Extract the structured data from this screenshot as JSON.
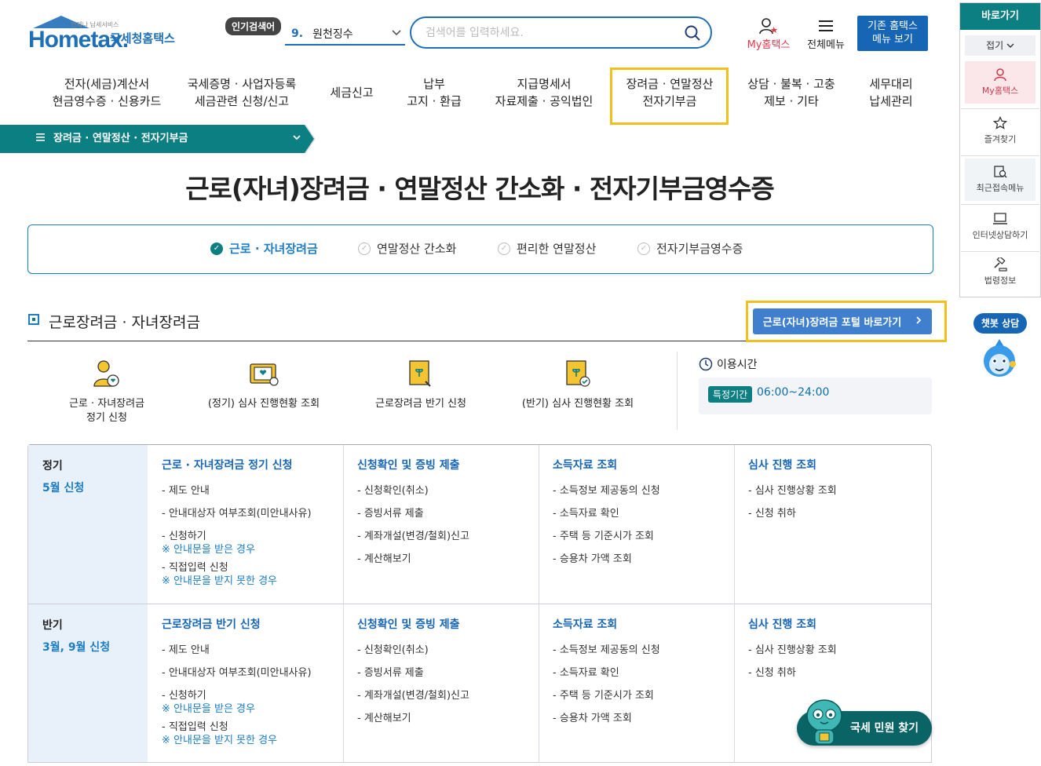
{
  "logo": {
    "brand": "Hometax.",
    "sub": "국세청홈택스",
    "tagline": "언제나 납세서비스"
  },
  "header": {
    "popular_badge": "인기검색어",
    "popular_rank": "9.",
    "popular_term": "원천징수",
    "search_placeholder": "검색어를 입력하세요.",
    "my_hometax": "My홈택스",
    "all_menu": "전체메뉴",
    "old_hometax_l1": "기존 홈택스",
    "old_hometax_l2": "메뉴 보기"
  },
  "gnb": [
    {
      "l1": "전자(세금)계산서",
      "l2": "현금영수증 · 신용카드"
    },
    {
      "l1": "국세증명 · 사업자등록",
      "l2": "세금관련 신청/신고"
    },
    {
      "l1": "세금신고",
      "l2": ""
    },
    {
      "l1": "납부",
      "l2": "고지 · 환급"
    },
    {
      "l1": "지급명세서",
      "l2": "자료제출 · 공익법인"
    },
    {
      "l1": "장려금 · 연말정산",
      "l2": "전자기부금"
    },
    {
      "l1": "상담 · 불복 · 고충",
      "l2": "제보 · 기타"
    },
    {
      "l1": "세무대리",
      "l2": "납세관리"
    }
  ],
  "breadcrumb": {
    "label": "장려금 · 연말정산 · 전자기부금"
  },
  "page_title": "근로(자녀)장려금 · 연말정산 간소화 · 전자기부금영수증",
  "tabs": [
    {
      "label": "근로 · 자녀장려금"
    },
    {
      "label": "연말정산 간소화"
    },
    {
      "label": "편리한 연말정산"
    },
    {
      "label": "전자기부금영수증"
    }
  ],
  "section": {
    "title": "근로장려금 · 자녀장려금",
    "portal_button": "근로(자녀)장려금 포털 바로가기"
  },
  "quick_icons": [
    {
      "l1": "근로 · 자녀장려금",
      "l2": "정기 신청"
    },
    {
      "l1": "(정기) 심사 진행현황 조회",
      "l2": ""
    },
    {
      "l1": "근로장려금 반기 신청",
      "l2": ""
    },
    {
      "l1": "(반기) 심사 진행현황 조회",
      "l2": ""
    }
  ],
  "usage_time": {
    "label": "이용시간",
    "badge": "특정기간",
    "value": "06:00~24:00"
  },
  "table": {
    "rows": [
      {
        "head": "정기",
        "sub": "5월 신청",
        "cols": [
          {
            "title": "근로 · 자녀장려금 정기 신청",
            "items": [
              "- 제도 안내",
              "- 안내대상자 여부조회(미안내사유)",
              "- 신청하기"
            ],
            "note1": "※ 안내문을 받은 경우",
            "item4": "- 직접입력 신청",
            "note2": "※ 안내문을 받지 못한 경우"
          },
          {
            "title": "신청확인 및 증빙 제출",
            "items": [
              "- 신청확인(취소)",
              "- 증빙서류 제출",
              "- 계좌개설(변경/철회)신고",
              "- 계산해보기"
            ]
          },
          {
            "title": "소득자료 조회",
            "items": [
              "- 소득정보 제공동의 신청",
              "- 소득자료 확인",
              "- 주택 등 기준시가 조회",
              "- 승용차 가액 조회"
            ]
          },
          {
            "title": "심사 진행 조회",
            "items": [
              "- 심사 진행상황 조회",
              "- 신청 취하"
            ]
          }
        ]
      },
      {
        "head": "반기",
        "sub": "3월, 9월 신청",
        "cols": [
          {
            "title": "근로장려금 반기 신청",
            "items": [
              "- 제도 안내",
              "- 안내대상자 여부조회(미안내사유)",
              "- 신청하기"
            ],
            "note1": "※ 안내문을 받은 경우",
            "item4": "- 직접입력 신청",
            "note2": "※ 안내문을 받지 못한 경우"
          },
          {
            "title": "신청확인 및 증빙 제출",
            "items": [
              "- 신청확인(취소)",
              "- 증빙서류 제출",
              "- 계좌개설(변경/철회)신고",
              "- 계산해보기"
            ]
          },
          {
            "title": "소득자료 조회",
            "items": [
              "- 소득정보 제공동의 신청",
              "- 소득자료 확인",
              "- 주택 등 기준시가 조회",
              "- 승용차 가액 조회"
            ]
          },
          {
            "title": "심사 진행 조회",
            "items": [
              "- 심사 진행상황 조회",
              "- 신청 취하"
            ]
          }
        ]
      }
    ]
  },
  "quick_panel": {
    "title": "바로가기",
    "fold": "접기",
    "items": [
      "My홈택스",
      "즐겨찾기",
      "최근접속메뉴",
      "인터넷상담하기",
      "법령정보"
    ]
  },
  "chatbot": {
    "label": "챗봇 상담"
  },
  "civil_search": {
    "label": "국세 민원 찾기"
  },
  "colors": {
    "primary": "#1f6fb7",
    "teal": "#0c7f82",
    "highlight": "#f2c01d",
    "accent_red": "#e33a4c"
  }
}
